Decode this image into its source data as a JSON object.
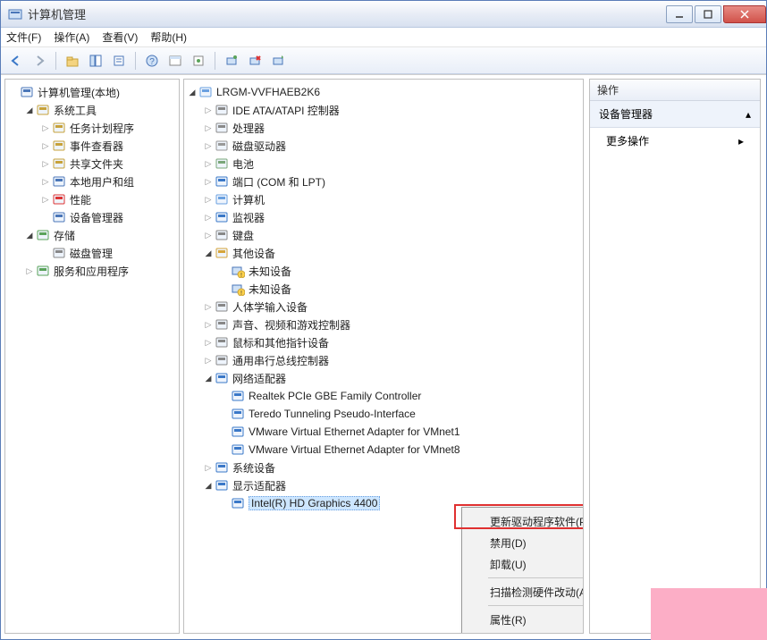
{
  "window": {
    "title": "计算机管理"
  },
  "menubar": [
    "文件(F)",
    "操作(A)",
    "查看(V)",
    "帮助(H)"
  ],
  "left_tree": [
    {
      "d": 0,
      "tw": "",
      "icon": "mgmt",
      "label": "计算机管理(本地)"
    },
    {
      "d": 1,
      "tw": "open",
      "icon": "tools",
      "label": "系统工具"
    },
    {
      "d": 2,
      "tw": "close",
      "icon": "sched",
      "label": "任务计划程序"
    },
    {
      "d": 2,
      "tw": "close",
      "icon": "event",
      "label": "事件查看器"
    },
    {
      "d": 2,
      "tw": "close",
      "icon": "share",
      "label": "共享文件夹"
    },
    {
      "d": 2,
      "tw": "close",
      "icon": "users",
      "label": "本地用户和组"
    },
    {
      "d": 2,
      "tw": "close",
      "icon": "perf",
      "label": "性能"
    },
    {
      "d": 2,
      "tw": "",
      "icon": "devmgr",
      "label": "设备管理器"
    },
    {
      "d": 1,
      "tw": "open",
      "icon": "storage",
      "label": "存储"
    },
    {
      "d": 2,
      "tw": "",
      "icon": "disk",
      "label": "磁盘管理"
    },
    {
      "d": 1,
      "tw": "close",
      "icon": "svc",
      "label": "服务和应用程序"
    }
  ],
  "mid_tree": [
    {
      "d": 0,
      "tw": "open",
      "icon": "pc",
      "label": "LRGM-VVFHAEB2K6"
    },
    {
      "d": 1,
      "tw": "close",
      "icon": "ide",
      "label": "IDE ATA/ATAPI 控制器"
    },
    {
      "d": 1,
      "tw": "close",
      "icon": "cpu",
      "label": "处理器"
    },
    {
      "d": 1,
      "tw": "close",
      "icon": "dvd",
      "label": "磁盘驱动器"
    },
    {
      "d": 1,
      "tw": "close",
      "icon": "batt",
      "label": "电池"
    },
    {
      "d": 1,
      "tw": "close",
      "icon": "port",
      "label": "端口 (COM 和 LPT)"
    },
    {
      "d": 1,
      "tw": "close",
      "icon": "pc",
      "label": "计算机"
    },
    {
      "d": 1,
      "tw": "close",
      "icon": "mon",
      "label": "监视器"
    },
    {
      "d": 1,
      "tw": "close",
      "icon": "kbd",
      "label": "键盘"
    },
    {
      "d": 1,
      "tw": "open",
      "icon": "other",
      "label": "其他设备"
    },
    {
      "d": 2,
      "tw": "",
      "icon": "warn",
      "label": "未知设备"
    },
    {
      "d": 2,
      "tw": "",
      "icon": "warn",
      "label": "未知设备"
    },
    {
      "d": 1,
      "tw": "close",
      "icon": "hid",
      "label": "人体学输入设备"
    },
    {
      "d": 1,
      "tw": "close",
      "icon": "snd",
      "label": "声音、视频和游戏控制器"
    },
    {
      "d": 1,
      "tw": "close",
      "icon": "mouse",
      "label": "鼠标和其他指针设备"
    },
    {
      "d": 1,
      "tw": "close",
      "icon": "usb",
      "label": "通用串行总线控制器"
    },
    {
      "d": 1,
      "tw": "open",
      "icon": "net",
      "label": "网络适配器"
    },
    {
      "d": 2,
      "tw": "",
      "icon": "nic",
      "label": "Realtek PCIe GBE Family Controller"
    },
    {
      "d": 2,
      "tw": "",
      "icon": "nic",
      "label": "Teredo Tunneling Pseudo-Interface"
    },
    {
      "d": 2,
      "tw": "",
      "icon": "nic",
      "label": "VMware Virtual Ethernet Adapter for VMnet1"
    },
    {
      "d": 2,
      "tw": "",
      "icon": "nic",
      "label": "VMware Virtual Ethernet Adapter for VMnet8"
    },
    {
      "d": 1,
      "tw": "close",
      "icon": "sys",
      "label": "系统设备"
    },
    {
      "d": 1,
      "tw": "open",
      "icon": "disp",
      "label": "显示适配器"
    },
    {
      "d": 2,
      "tw": "",
      "icon": "gpu",
      "label": "Intel(R) HD Graphics 4400",
      "sel": true
    }
  ],
  "context_menu": [
    {
      "label": "更新驱动程序软件(P)..."
    },
    {
      "label": "禁用(D)"
    },
    {
      "label": "卸载(U)"
    },
    {
      "sep": true
    },
    {
      "label": "扫描检测硬件改动(A)"
    },
    {
      "sep": true
    },
    {
      "label": "属性(R)"
    }
  ],
  "right": {
    "header": "操作",
    "section": "设备管理器",
    "item": "更多操作"
  }
}
